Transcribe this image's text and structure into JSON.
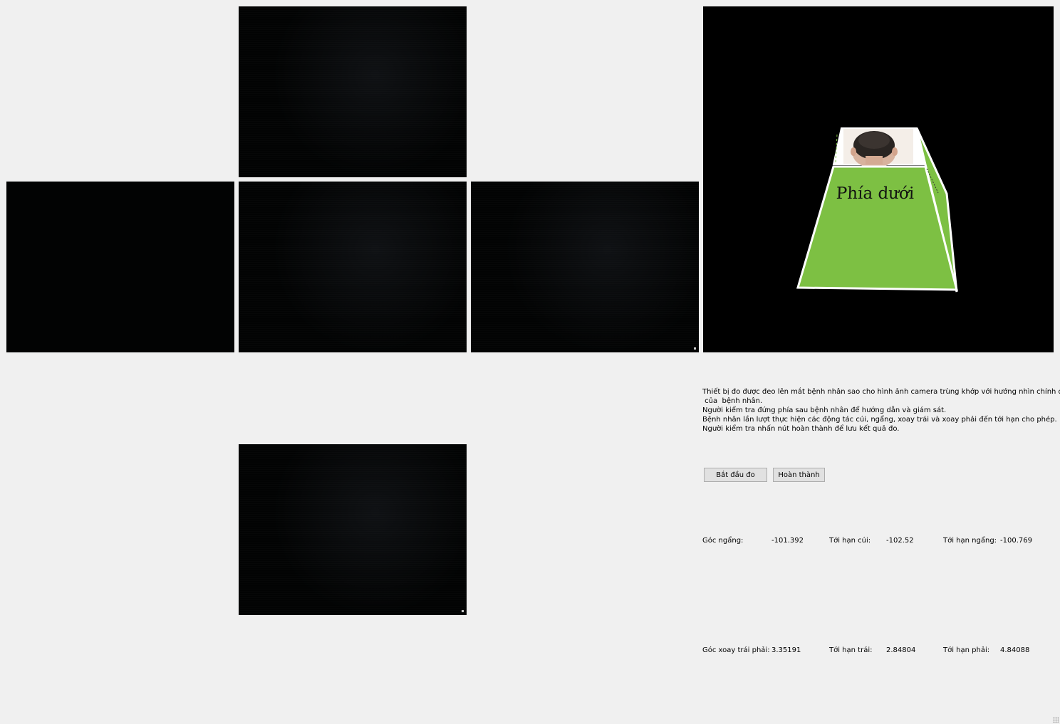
{
  "cameras": [
    "camera-top",
    "camera-left",
    "camera-center",
    "camera-right",
    "camera-bottom"
  ],
  "model3d": {
    "face_label": "Phía dưới",
    "top_face_image": "head-back-photo",
    "face_color": "#7dc043",
    "background": "#000000"
  },
  "instructions": [
    "Thiết bị đo được đeo lên mắt bệnh nhân sao cho hình ảnh camera trùng khớp với hướng nhìn chính diện",
    " của  bệnh nhân.",
    "Người kiểm tra đứng phía sau bệnh nhân để hướng dẫn và giám sát.",
    "Bệnh nhân lần lượt thực hiện các động tác cúi, ngẩng, xoay trái và xoay phải đến tới hạn cho phép.",
    "Người kiểm tra nhấn nút hoàn thành để lưu kết quả đo."
  ],
  "buttons": {
    "start": "Bắt đầu đo",
    "finish": "Hoàn thành"
  },
  "measure": {
    "pitch": {
      "label": "Góc ngẩng:",
      "value": "-101.392",
      "min_label": "Tới hạn cúi:",
      "min_value": "-102.52",
      "max_label": "Tới hạn ngẩng:",
      "max_value": "-100.769"
    },
    "yaw": {
      "label": "Góc xoay trái phải:",
      "value": "3.35191",
      "min_label": "Tới hạn trái:",
      "min_value": "2.84804",
      "max_label": "Tới hạn phải:",
      "max_value": "4.84088"
    }
  }
}
